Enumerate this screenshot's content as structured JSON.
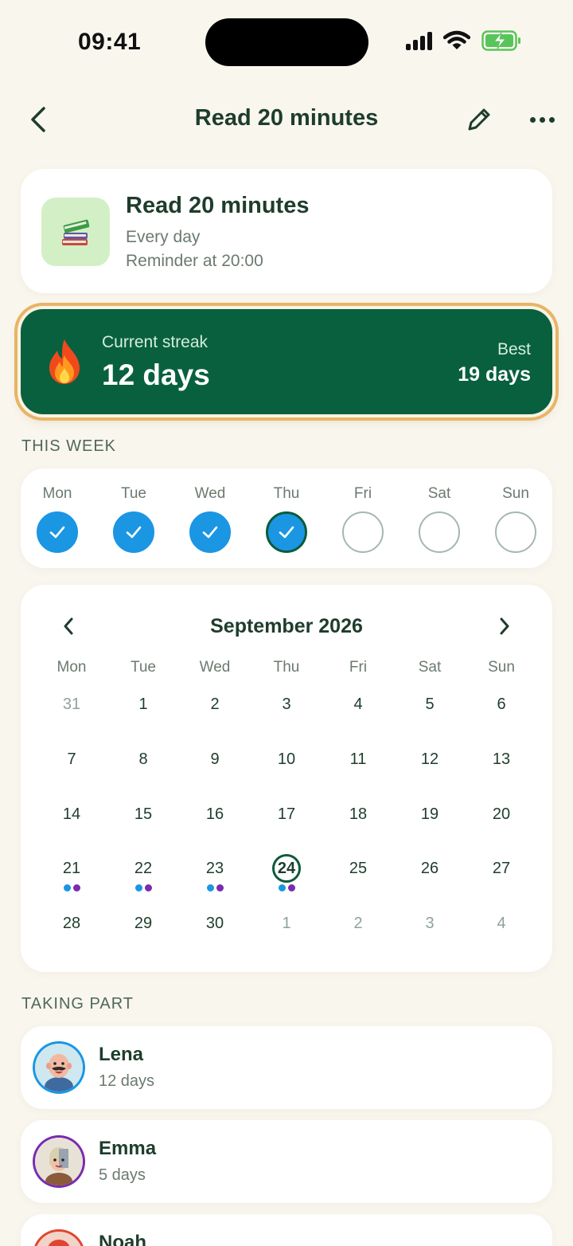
{
  "status_bar": {
    "time": "09:41"
  },
  "nav": {
    "title": "Read 20 minutes"
  },
  "habit": {
    "title": "Read 20 minutes",
    "frequency": "Every day",
    "reminder": "Reminder at 20:00",
    "icon": "books-icon",
    "icon_bg": "#d3efc6"
  },
  "streak": {
    "label": "Current streak",
    "value": "12 days",
    "best_label": "Best",
    "best_value": "19 days",
    "bg_color": "#08603f"
  },
  "week": {
    "heading": "THIS WEEK",
    "days": [
      {
        "label": "Mon",
        "status": "done"
      },
      {
        "label": "Tue",
        "status": "done"
      },
      {
        "label": "Wed",
        "status": "done"
      },
      {
        "label": "Thu",
        "status": "done-today"
      },
      {
        "label": "Fri",
        "status": "empty"
      },
      {
        "label": "Sat",
        "status": "empty"
      },
      {
        "label": "Sun",
        "status": "empty"
      }
    ]
  },
  "calendar": {
    "month": "September 2026",
    "weekdays": [
      "Mon",
      "Tue",
      "Wed",
      "Thu",
      "Fri",
      "Sat",
      "Sun"
    ],
    "weeks": [
      [
        {
          "d": "31",
          "m": true
        },
        {
          "d": "1"
        },
        {
          "d": "2"
        },
        {
          "d": "3"
        },
        {
          "d": "4"
        },
        {
          "d": "5"
        },
        {
          "d": "6"
        }
      ],
      [
        {
          "d": "7"
        },
        {
          "d": "8"
        },
        {
          "d": "9"
        },
        {
          "d": "10"
        },
        {
          "d": "11"
        },
        {
          "d": "12"
        },
        {
          "d": "13"
        }
      ],
      [
        {
          "d": "14"
        },
        {
          "d": "15"
        },
        {
          "d": "16"
        },
        {
          "d": "17"
        },
        {
          "d": "18"
        },
        {
          "d": "19"
        },
        {
          "d": "20"
        }
      ],
      [
        {
          "d": "21",
          "dots": [
            "blue",
            "purple"
          ]
        },
        {
          "d": "22",
          "dots": [
            "blue",
            "purple"
          ]
        },
        {
          "d": "23",
          "dots": [
            "blue",
            "purple"
          ]
        },
        {
          "d": "24",
          "today": true,
          "dots": [
            "blue",
            "purple"
          ]
        },
        {
          "d": "25"
        },
        {
          "d": "26"
        },
        {
          "d": "27"
        }
      ],
      [
        {
          "d": "28"
        },
        {
          "d": "29"
        },
        {
          "d": "30"
        },
        {
          "d": "1",
          "m": true
        },
        {
          "d": "2",
          "m": true
        },
        {
          "d": "3",
          "m": true
        },
        {
          "d": "4",
          "m": true
        }
      ]
    ],
    "dot_colors": {
      "blue": "#1a96e3",
      "purple": "#7a2bb0"
    }
  },
  "participants": {
    "heading": "TAKING PART",
    "items": [
      {
        "name": "Lena",
        "streak": "12 days",
        "ring": "#1a96e3"
      },
      {
        "name": "Emma",
        "streak": "5 days",
        "ring": "#7a2bb0"
      },
      {
        "name": "Noah",
        "streak": "",
        "ring": "#e0452f"
      }
    ]
  }
}
